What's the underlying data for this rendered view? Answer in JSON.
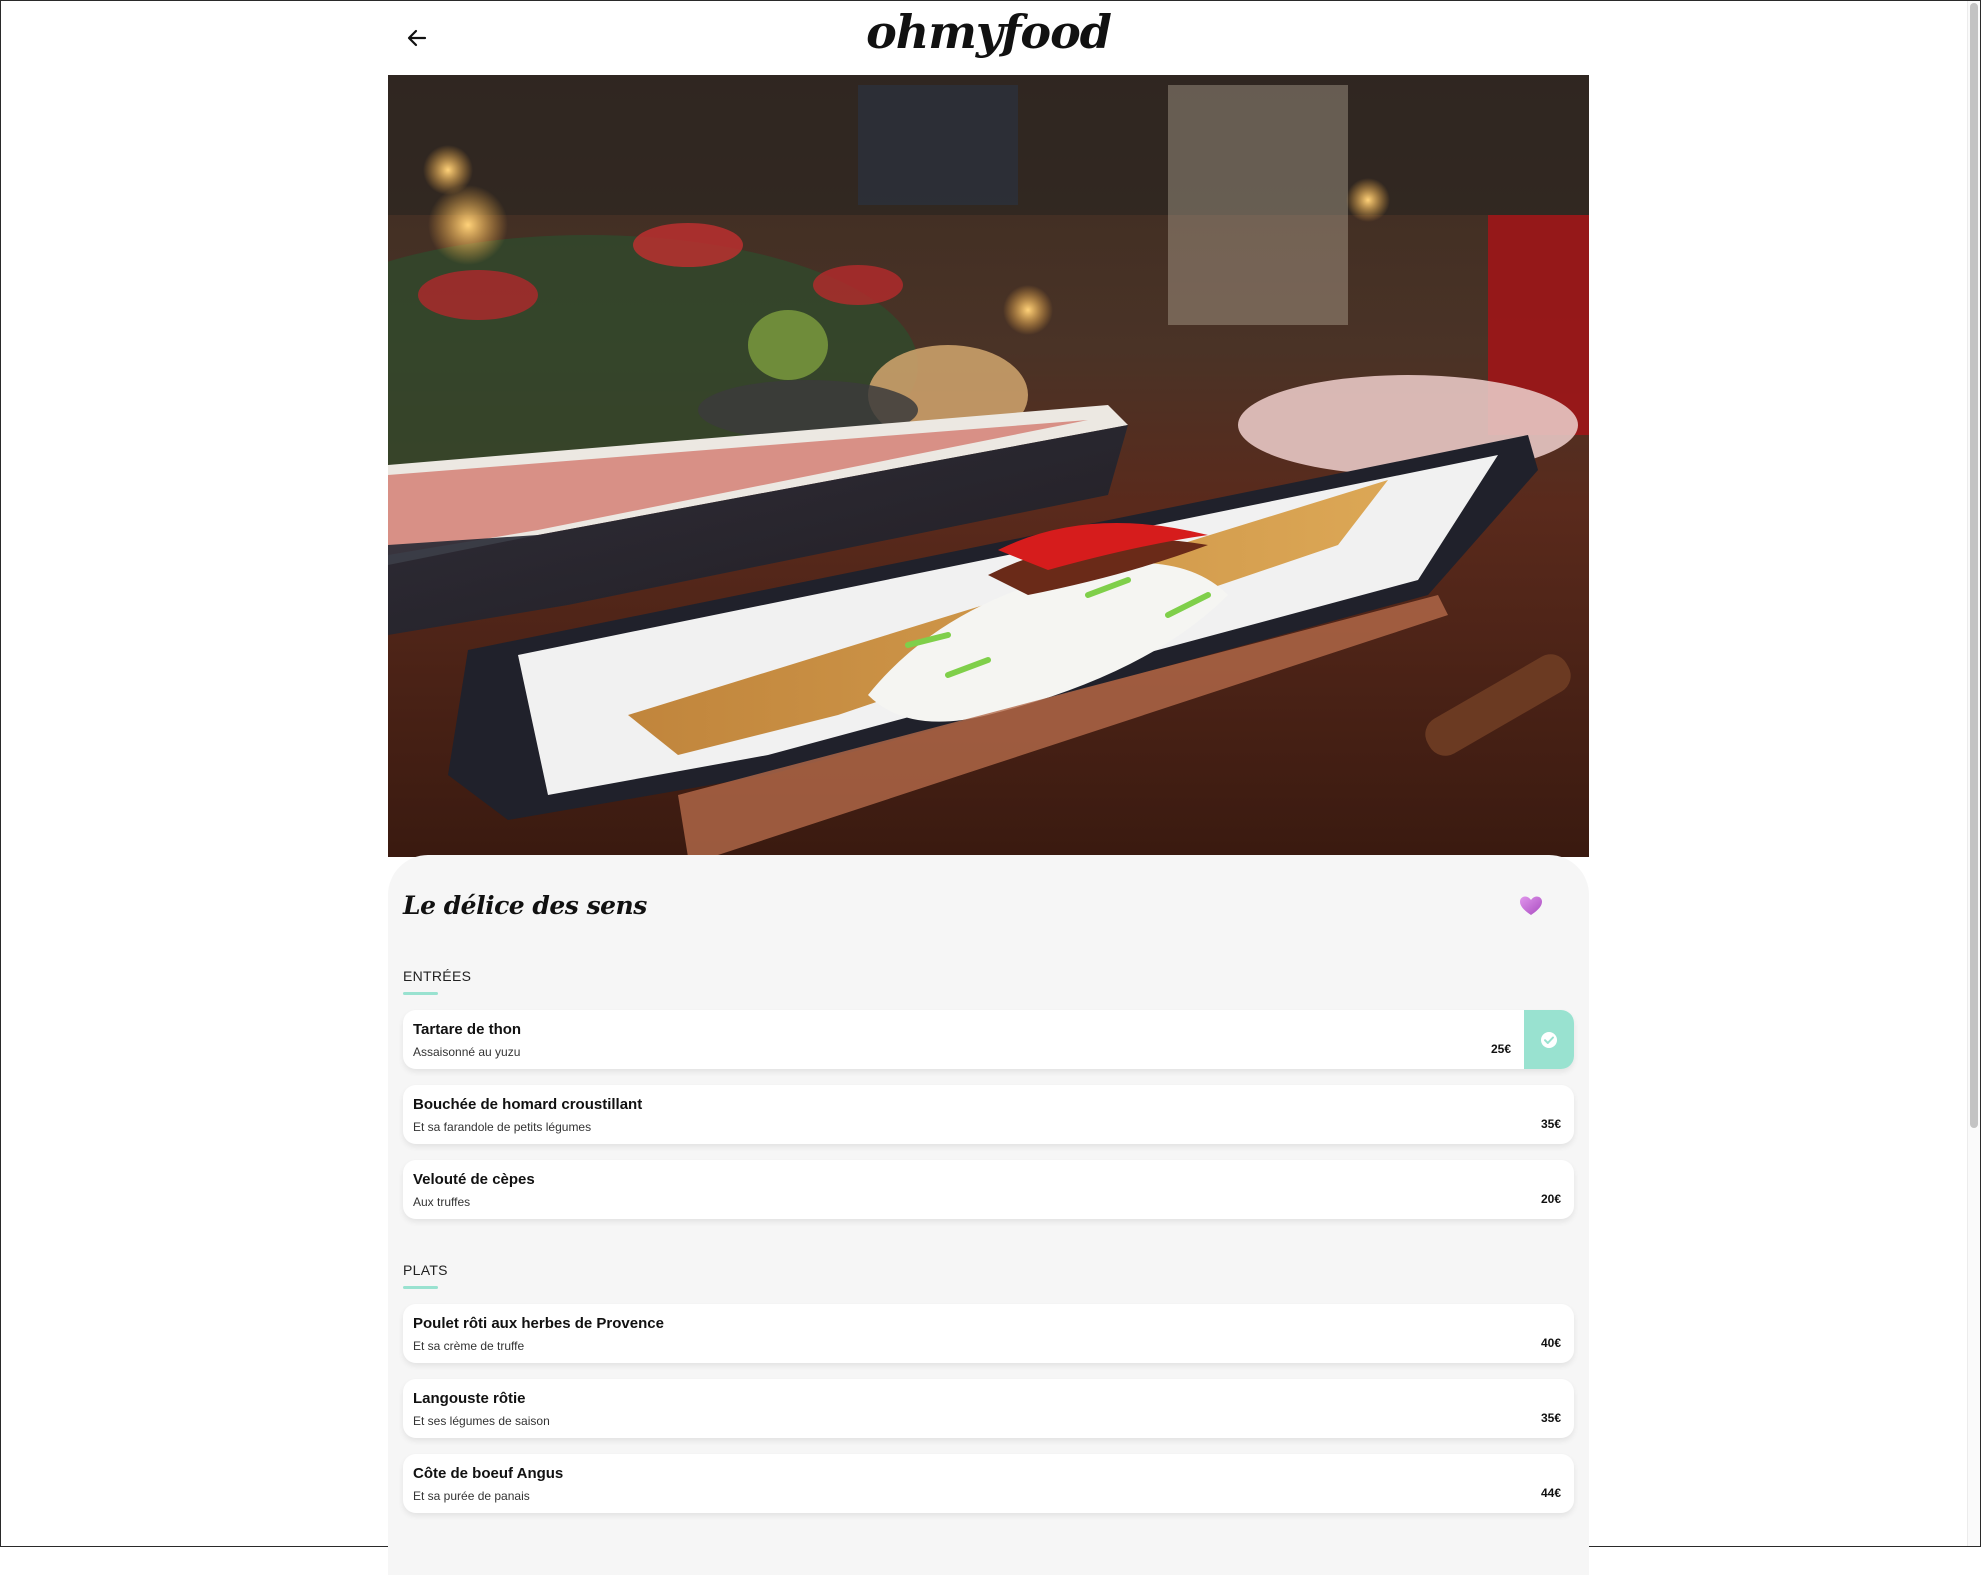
{
  "header": {
    "logo": "ohmyfood",
    "back_icon": "arrow-left-icon"
  },
  "restaurant": {
    "name": "Le délice des sens",
    "favorite_icon": "heart-icon",
    "favorite_color": "#c973d6"
  },
  "accent_color": "#99e2d0",
  "sections": [
    {
      "title": "ENTRÉES",
      "dishes": [
        {
          "name": "Tartare de thon",
          "description": "Assaisonné au yuzu",
          "price": "25€",
          "selected": true
        },
        {
          "name": "Bouchée de homard croustillant",
          "description": "Et sa farandole de petits légumes",
          "price": "35€",
          "selected": false
        },
        {
          "name": "Velouté de cèpes",
          "description": "Aux truffes",
          "price": "20€",
          "selected": false
        }
      ]
    },
    {
      "title": "PLATS",
      "dishes": [
        {
          "name": "Poulet rôti aux herbes de Provence",
          "description": "Et sa crème de truffe",
          "price": "40€",
          "selected": false
        },
        {
          "name": "Langouste rôtie",
          "description": "Et ses légumes de saison",
          "price": "35€",
          "selected": false
        },
        {
          "name": "Côte de boeuf Angus",
          "description": "Et sa purée de panais",
          "price": "44€",
          "selected": false
        }
      ]
    }
  ]
}
